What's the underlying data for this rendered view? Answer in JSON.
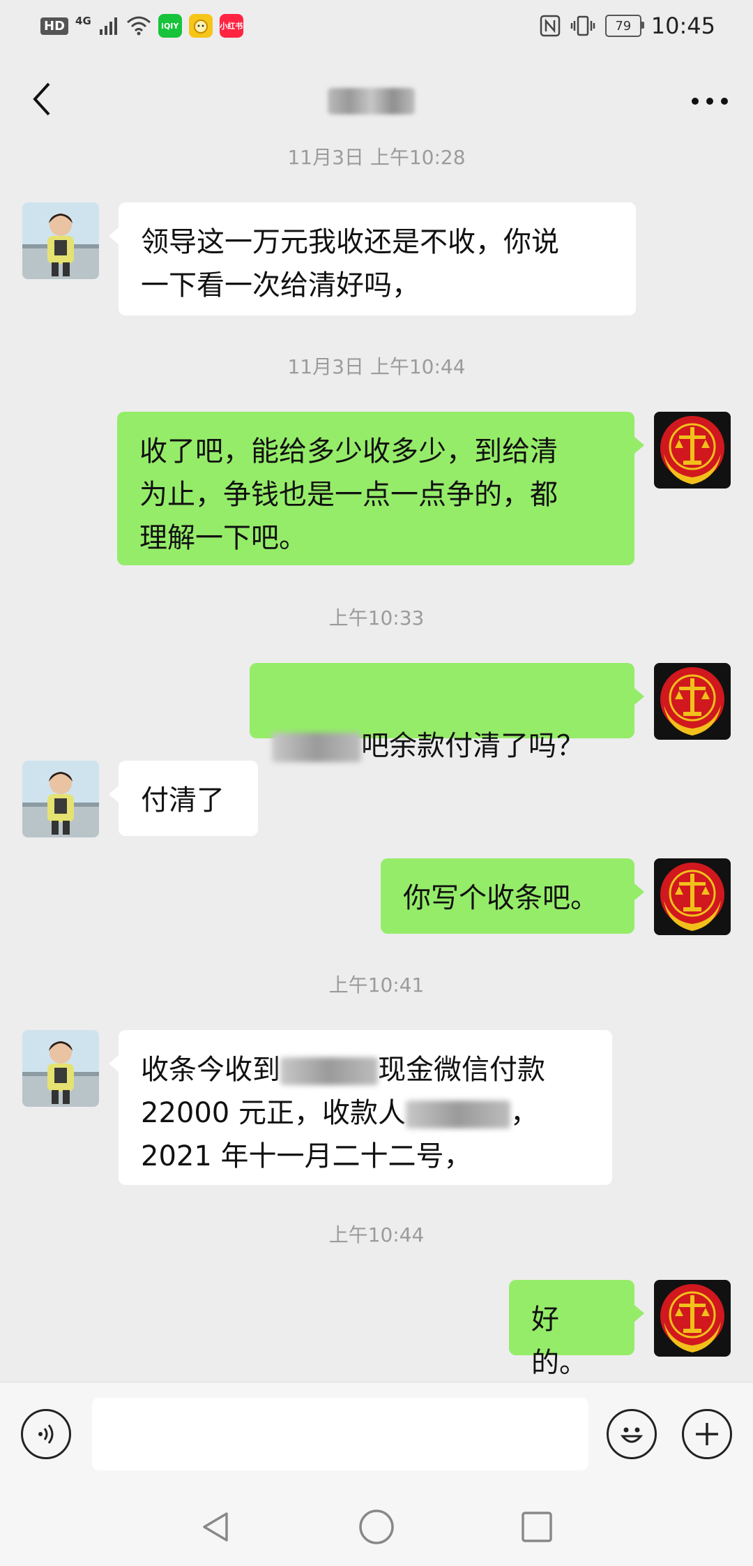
{
  "status_bar": {
    "hd": "HD",
    "network": "4G",
    "battery": "79",
    "time": "10:45",
    "apps": [
      {
        "name": "iqiyi",
        "label": "iQIY",
        "color": "#17c33a"
      },
      {
        "name": "game",
        "label": "",
        "color": "#f5c518"
      },
      {
        "name": "xiaohongshu",
        "label": "小红书",
        "color": "#ff2442"
      }
    ]
  },
  "header": {
    "back_icon": "chevron-left-icon",
    "more_icon": "more-dots-icon"
  },
  "timestamps": {
    "t1": "11月3日 上午10:28",
    "t2": "11月3日 上午10:44",
    "t3": "上午10:33",
    "t4": "上午10:41",
    "t5": "上午10:44"
  },
  "messages": {
    "m1": "领导这一万元我收还是不收，你说\n一下看一次给清好吗，",
    "m2": "收了吧，能给多少收多少，到给清\n为止，争钱也是一点一点争的，都\n理解一下吧。",
    "m3_suffix": "吧余款付清了吗？",
    "m4": "付清了",
    "m5": "你写个收条吧。",
    "m6_line1_a": "收条今收到",
    "m6_line1_b": "现金微信付款",
    "m6_line2_a": "22000 元正，收款人",
    "m6_line2_b": "，",
    "m6_line3": "2021 年十一月二十二号，",
    "m7": "好的。"
  },
  "input": {
    "placeholder": ""
  },
  "colors": {
    "background": "#ededed",
    "outgoing_bubble": "#95ec69",
    "incoming_bubble": "#ffffff",
    "emblem_red": "#d0181e",
    "emblem_gold": "#f2c01b"
  }
}
